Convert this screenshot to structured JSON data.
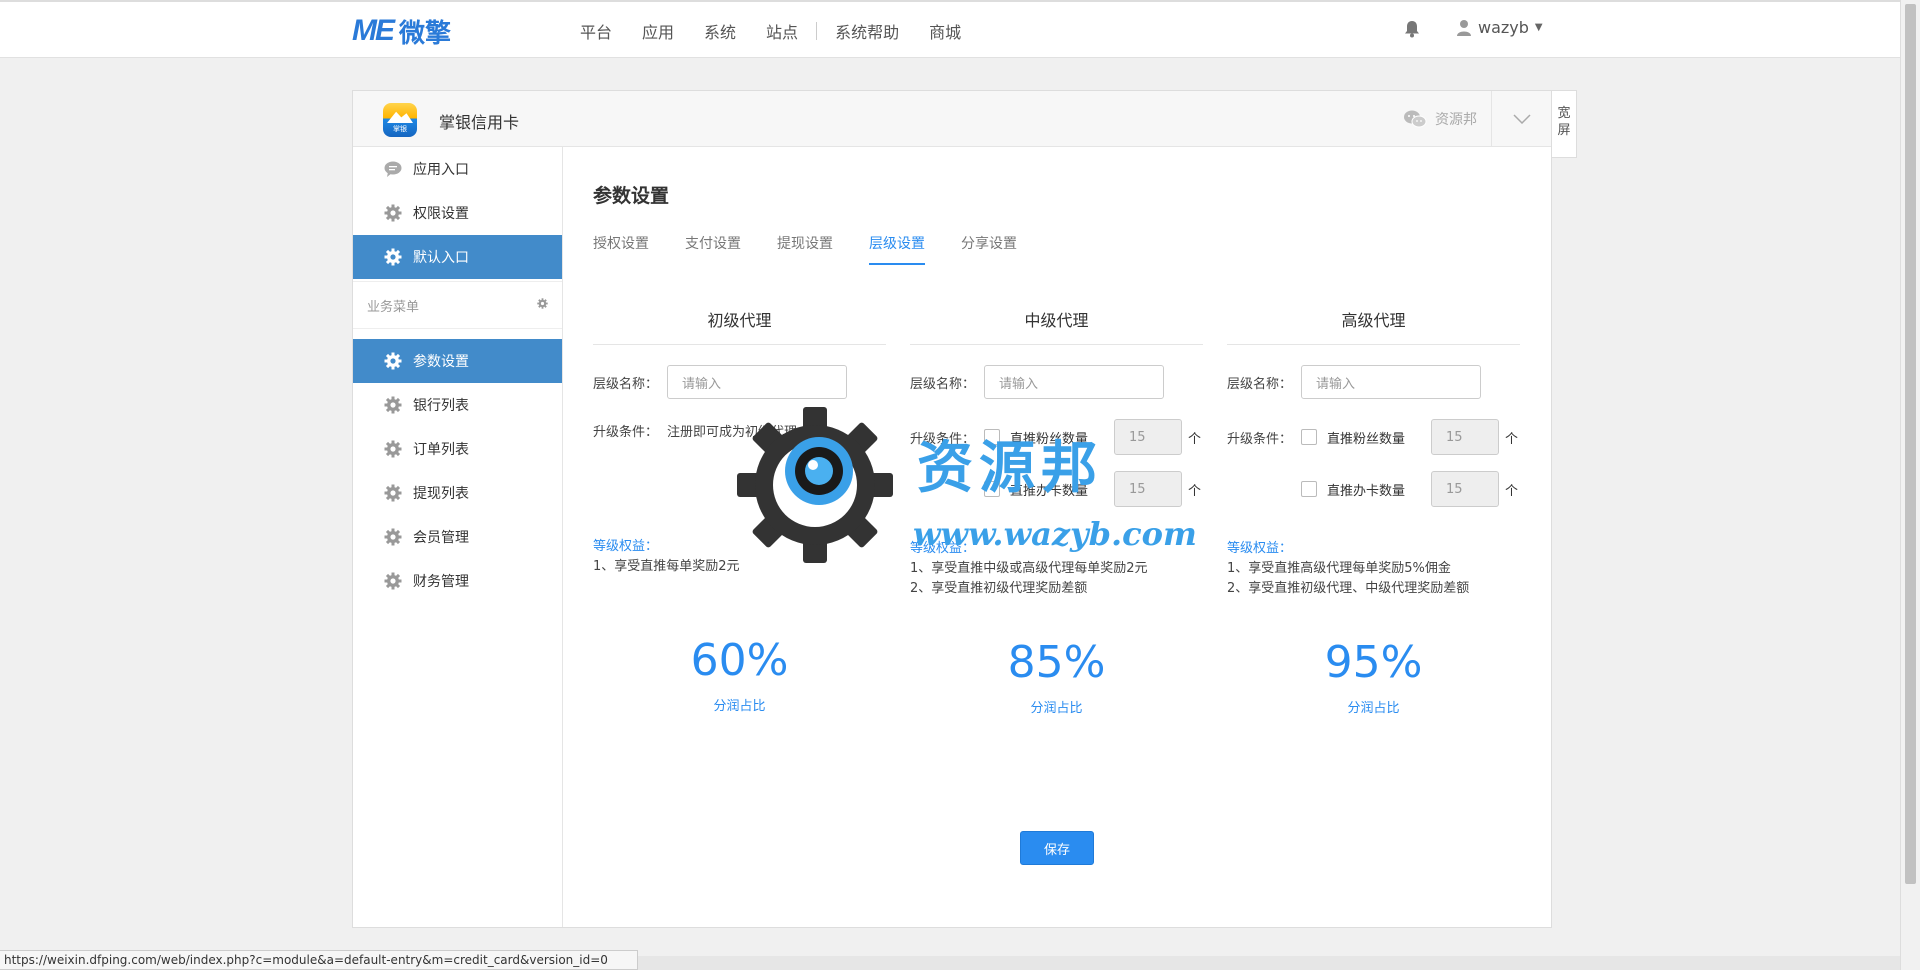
{
  "topbar": {
    "logo_me": "ME",
    "logo_cn": "微擎",
    "nav": [
      "平台",
      "应用",
      "系统",
      "站点",
      "系统帮助",
      "商城"
    ],
    "username": "wazyb"
  },
  "app": {
    "name": "掌银信用卡",
    "icon_tag": "掌银",
    "account_label": "资源邦",
    "wide_label": "宽屏"
  },
  "sidebar": {
    "top_items": [
      {
        "label": "应用入口",
        "icon": "chat-icon"
      },
      {
        "label": "权限设置",
        "icon": "gear-icon"
      },
      {
        "label": "默认入口",
        "icon": "gear-icon"
      }
    ],
    "group_label": "业务菜单",
    "biz_items": [
      {
        "label": "参数设置",
        "icon": "gear-icon"
      },
      {
        "label": "银行列表",
        "icon": "gear-icon"
      },
      {
        "label": "订单列表",
        "icon": "gear-icon"
      },
      {
        "label": "提现列表",
        "icon": "gear-icon"
      },
      {
        "label": "会员管理",
        "icon": "gear-icon"
      },
      {
        "label": "财务管理",
        "icon": "gear-icon"
      }
    ]
  },
  "page": {
    "title": "参数设置",
    "tabs": [
      "授权设置",
      "支付设置",
      "提现设置",
      "层级设置",
      "分享设置"
    ],
    "active_tab": "层级设置"
  },
  "levels": [
    {
      "title": "初级代理",
      "name_label": "层级名称：",
      "name_placeholder": "请输入",
      "cond_label": "升级条件：",
      "cond_text": "注册即可成为初级代理",
      "benefit_title": "等级权益：",
      "benefits": [
        "1、享受直推每单奖励2元"
      ],
      "percent": "60%",
      "percent_label": "分润占比"
    },
    {
      "title": "中级代理",
      "name_label": "层级名称：",
      "name_placeholder": "请输入",
      "cond_label": "升级条件：",
      "fans_label": "直推粉丝数量",
      "fans_value": "15",
      "cards_label": "直推办卡数量",
      "cards_value": "15",
      "unit": "个",
      "benefit_title": "等级权益：",
      "benefits": [
        "1、享受直推中级或高级代理每单奖励2元",
        "2、享受直推初级代理奖励差额"
      ],
      "percent": "85%",
      "percent_label": "分润占比"
    },
    {
      "title": "高级代理",
      "name_label": "层级名称：",
      "name_placeholder": "请输入",
      "cond_label": "升级条件：",
      "fans_label": "直推粉丝数量",
      "fans_value": "15",
      "cards_label": "直推办卡数量",
      "cards_value": "15",
      "unit": "个",
      "benefit_title": "等级权益：",
      "benefits": [
        "1、享受直推高级代理每单奖励5%佣金",
        "2、享受直推初级代理、中级代理奖励差额"
      ],
      "percent": "95%",
      "percent_label": "分润占比"
    }
  ],
  "save_label": "保存",
  "watermark": {
    "cn": "资源邦",
    "url": "www.wazyb.com"
  },
  "status_url": "https://weixin.dfping.com/web/index.php?c=module&a=default-entry&m=credit_card&version_id=0",
  "colors": {
    "accent": "#2a8cf0",
    "sidebar_active": "#428bca",
    "logo": "#2a7ad8"
  }
}
